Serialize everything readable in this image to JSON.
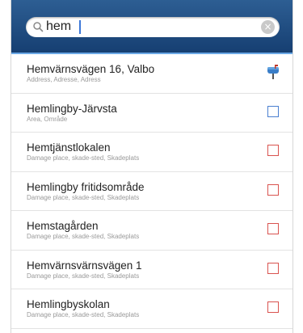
{
  "search": {
    "value": "hem",
    "clear_icon": "×"
  },
  "results": [
    {
      "title": "Hemvärnsvägen 16, Valbo",
      "subtitle": "Address, Adresse, Adress",
      "icon": "mailbox-icon"
    },
    {
      "title": "Hemlingby-Järvsta",
      "subtitle": "Area, Område",
      "icon": "square-outline-blue-icon"
    },
    {
      "title": "Hemtjänstlokalen",
      "subtitle": "Damage place, skade-sted, Skadeplats",
      "icon": "square-outline-red-icon"
    },
    {
      "title": "Hemlingby fritidsområde",
      "subtitle": "Damage place, skade-sted, Skadeplats",
      "icon": "square-outline-red-icon"
    },
    {
      "title": "Hemstagården",
      "subtitle": "Damage place, skade-sted, Skadeplats",
      "icon": "square-outline-red-icon"
    },
    {
      "title": "Hemvärnsvärnsvägen 1",
      "subtitle": "Damage place, skade-sted, Skadeplats",
      "icon": "square-outline-red-icon"
    },
    {
      "title": "Hemlingbyskolan",
      "subtitle": "Damage place, skade-sted, Skadeplats",
      "icon": "square-outline-red-icon"
    }
  ],
  "colors": {
    "header_top": "#2d5e93",
    "header_bottom": "#163f72",
    "accent": "#6aa8e6",
    "damage_place": "#d9534f",
    "area": "#4a7fd0"
  }
}
